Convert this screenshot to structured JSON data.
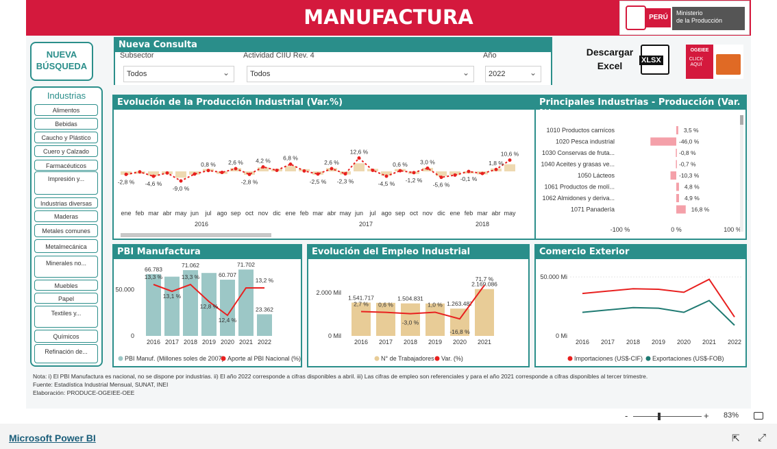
{
  "header": {
    "title": "MANUFACTURA",
    "logo_country": "PERÚ",
    "logo_ministry": "Ministerio\nde la Producción"
  },
  "buttons": {
    "new_search": "NUEVA BÚSQUEDA",
    "download_label": "Descargar Excel",
    "xlsx": "XLSX",
    "ogeiee": "OGEIEE",
    "click": "CLICK AQUÍ"
  },
  "query": {
    "title": "Nueva Consulta",
    "subsector_label": "Subsector",
    "subsector_value": "Todos",
    "ciiu_label": "Actividad CIIU Rev. 4",
    "ciiu_value": "Todos",
    "year_label": "Año",
    "year_value": "2022"
  },
  "industries": {
    "title": "Industrias",
    "items": [
      "Alimentos",
      "Bebidas",
      "Caucho y Plástico",
      "Cuero y Calzado",
      "Farmacéuticos",
      "Impresión y...",
      "Industrias diversas",
      "Maderas",
      "Metales comunes",
      "Metalmecánica",
      "Minerales no...",
      "Muebles",
      "Papel",
      "Textiles y...",
      "Químicos",
      "Refinación de..."
    ]
  },
  "notes": {
    "line1": "Nota: i) El PBI Manufactura es nacional, no se dispone por industrias. ii) El año 2022 corresponde a cifras disponibles a abril. iii) Las cifras de empleo son referenciales y para el año 2021 corresponde a cifras disponibles al tercer trimestre.",
    "line2": "Fuente: Estadística Industrial Mensual, SUNAT, INEI",
    "line3": "Elaboración: PRODUCE-OGEIEE-OEE"
  },
  "footer": {
    "zoom": "83%",
    "brand": "Microsoft Power BI",
    "minus": "-",
    "plus": "+"
  },
  "colors": {
    "brand_red": "#d4193d",
    "teal": "#2a8e8a",
    "bar_tan": "#e8cc97",
    "bar_teal": "#9cc7c6",
    "line_red": "#e8201f",
    "pink": "#f4a0a9"
  },
  "chart_data": [
    {
      "type": "line",
      "title": "Evolución de la Producción Industrial (Var.%)",
      "months": [
        "ene",
        "feb",
        "mar",
        "abr",
        "may",
        "jun",
        "jul",
        "ago",
        "sep",
        "oct",
        "nov",
        "dic",
        "ene",
        "feb",
        "mar",
        "abr",
        "may",
        "jun",
        "jul",
        "ago",
        "sep",
        "oct",
        "nov",
        "dic",
        "ene",
        "feb",
        "mar",
        "abr",
        "may"
      ],
      "years": [
        "2016",
        "2017",
        "2018"
      ],
      "labels": [
        "-2,8 %",
        "-4,6 %",
        "-9,0 %",
        "0,8 %",
        "2,6 %",
        "-2,8 %",
        "4,2 %",
        "6,8 %",
        "-2,5 %",
        "2,6 %",
        "-2,3 %",
        "12,6 %",
        "-4,5 %",
        "0,6 %",
        "-1,2 %",
        "3,0 %",
        "-5,6 %",
        "-0,1 %",
        "1,8 %",
        "10,6 %"
      ],
      "values": [
        -2.8,
        -0.5,
        -4.6,
        -1.5,
        -9.0,
        -2.5,
        0.8,
        -1.0,
        2.6,
        -2.8,
        4.2,
        1.0,
        6.8,
        0.4,
        -2.5,
        2.6,
        -2.3,
        12.6,
        1.0,
        -4.5,
        0.6,
        -1.2,
        3.0,
        -5.6,
        -3.5,
        -0.1,
        -2.0,
        1.8,
        10.6
      ]
    },
    {
      "type": "bar",
      "title": "Principales Industrias - Producción (Var. %)",
      "categories": [
        "1010 Productos carnícos",
        "1020 Pesca industrial",
        "1030 Conservas de fruta...",
        "1040 Aceites y grasas ve...",
        "1050 Lácteos",
        "1061 Productos de molí...",
        "1062 Almidones y deriva...",
        "1071 Panadería"
      ],
      "values": [
        3.5,
        -46.0,
        -0.8,
        -0.7,
        -10.3,
        4.8,
        4.9,
        16.8
      ],
      "labels": [
        "3,5 %",
        "-46,0 %",
        "-0,8 %",
        "-0,7 %",
        "-10,3 %",
        "4,8 %",
        "4,9 %",
        "16,8 %"
      ],
      "xticks": [
        "-100 %",
        "0 %",
        "100 %"
      ],
      "xlim": [
        -100,
        100
      ]
    },
    {
      "type": "bar",
      "title": "PBI Manufactura",
      "categories": [
        "2016",
        "2017",
        "2018",
        "2019",
        "2020",
        "2021",
        "2022"
      ],
      "series": [
        {
          "name": "PBI Manuf. (Millones soles de 2007)",
          "values": [
            66783,
            64000,
            71062,
            68000,
            60707,
            71702,
            23362
          ],
          "labels": [
            "66.783",
            "",
            "71.062",
            "",
            "60.707",
            "71.702",
            "23.362"
          ]
        },
        {
          "name": "Aporte al PBI Nacional (%)",
          "values": [
            13.3,
            13.1,
            13.3,
            12.8,
            12.4,
            13.2,
            13.2
          ],
          "labels": [
            "13,3 %",
            "13,1 %",
            "13,3 %",
            "12,8 %",
            "12,4 %",
            "",
            "13,2 %"
          ]
        }
      ],
      "yticks": [
        "0",
        "50.000"
      ]
    },
    {
      "type": "bar",
      "title": "Evolución del Empleo Industrial",
      "categories": [
        "2016",
        "2017",
        "2018",
        "2019",
        "2020",
        "2021"
      ],
      "series": [
        {
          "name": "N° de Trabajadores",
          "values": [
            1541717,
            1530000,
            1504831,
            1500000,
            1263487,
            2169086
          ],
          "labels": [
            "1.541.717",
            "",
            "1.504.831",
            "",
            "1.263.487",
            "2.169.086"
          ]
        },
        {
          "name": "Var. (%)",
          "values": [
            2.7,
            0.6,
            -3.0,
            1.0,
            -16.8,
            71.7
          ],
          "labels": [
            "2,7 %",
            "0,6 %",
            "-3,0 %",
            "1,0 %",
            "-16,8 %",
            "71,7 %"
          ]
        }
      ],
      "yticks": [
        "0 Mil",
        "2.000 Mil"
      ]
    },
    {
      "type": "line",
      "title": "Comercio Exterior",
      "categories": [
        "2016",
        "2017",
        "2018",
        "2019",
        "2020",
        "2021",
        "2022"
      ],
      "series": [
        {
          "name": "Importaciones (US$-CIF)",
          "values": [
            36000,
            38000,
            40000,
            39500,
            37000,
            48000,
            16000
          ]
        },
        {
          "name": "Exportaciones (US$-FOB)",
          "values": [
            20000,
            22000,
            24000,
            23500,
            20000,
            30000,
            9000
          ]
        }
      ],
      "yticks": [
        "0 Mi",
        "50.000 Mi"
      ]
    }
  ]
}
